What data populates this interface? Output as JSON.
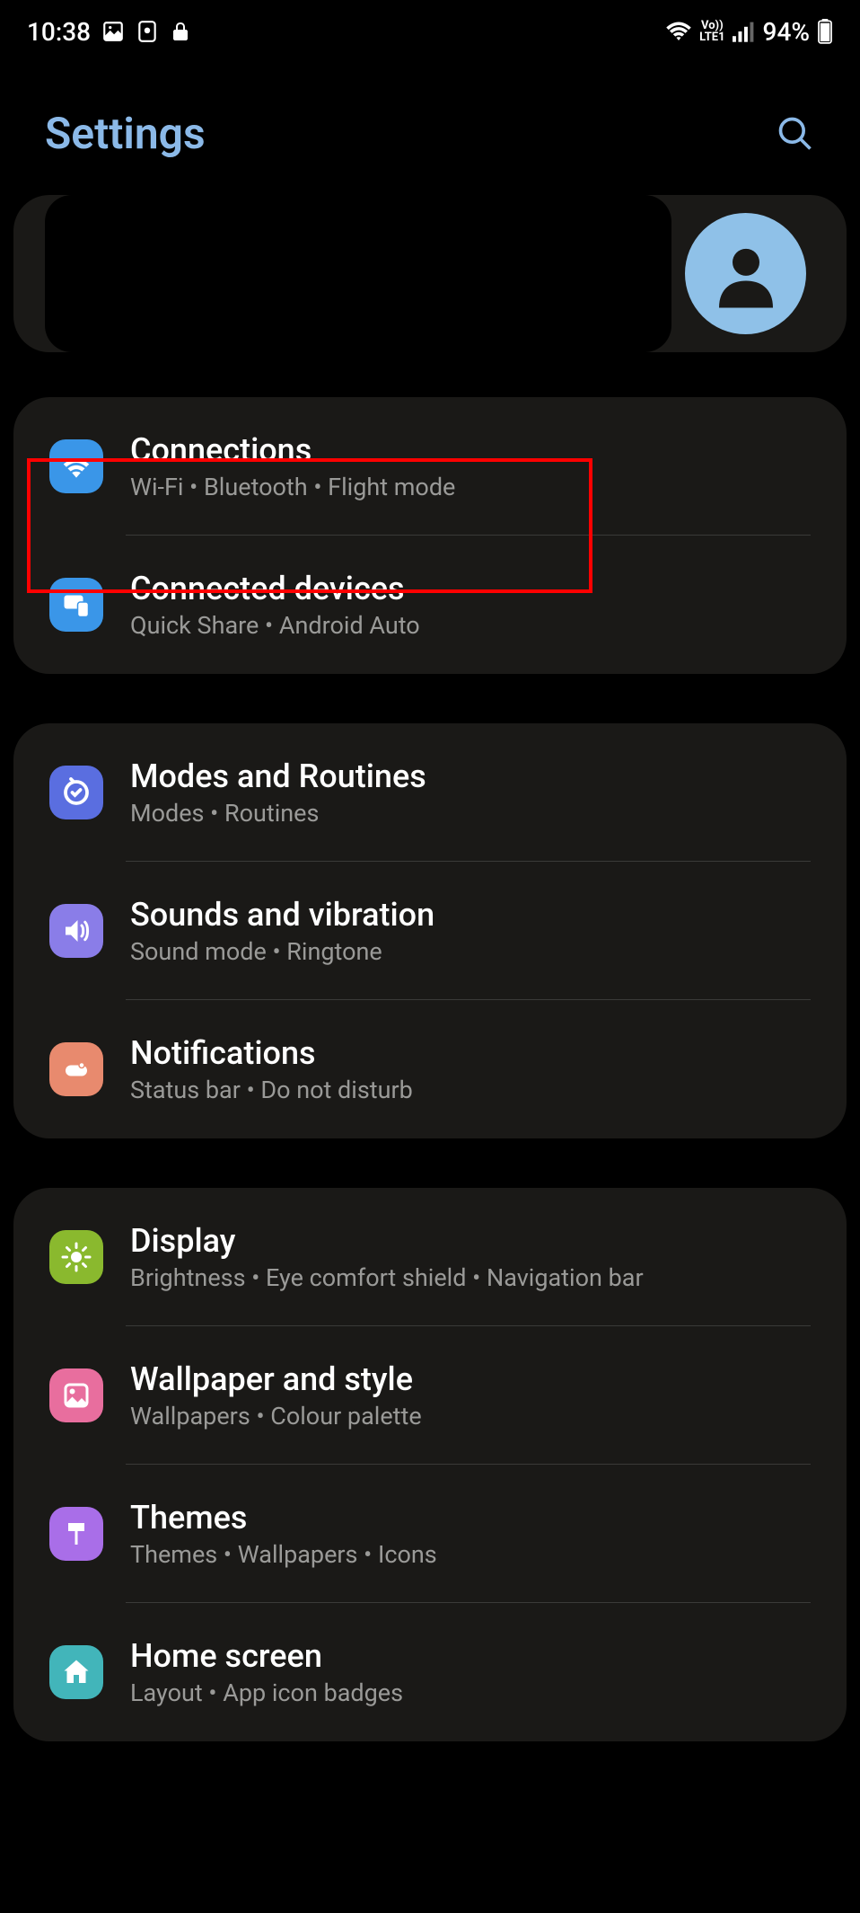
{
  "status_bar": {
    "time": "10:38",
    "battery": "94%",
    "lte_label": "Vo))\nLTE1"
  },
  "header": {
    "title": "Settings"
  },
  "groups": [
    {
      "items": [
        {
          "id": "connections",
          "title": "Connections",
          "subtitle": "Wi-Fi  •  Bluetooth  •  Flight mode",
          "icon_class": "icon-connections"
        },
        {
          "id": "connected-devices",
          "title": "Connected devices",
          "subtitle": "Quick Share  •  Android Auto",
          "icon_class": "icon-connected-devices"
        }
      ]
    },
    {
      "items": [
        {
          "id": "modes-routines",
          "title": "Modes and Routines",
          "subtitle": "Modes  •  Routines",
          "icon_class": "icon-modes"
        },
        {
          "id": "sounds-vibration",
          "title": "Sounds and vibration",
          "subtitle": "Sound mode  •  Ringtone",
          "icon_class": "icon-sounds"
        },
        {
          "id": "notifications",
          "title": "Notifications",
          "subtitle": "Status bar  •  Do not disturb",
          "icon_class": "icon-notifications"
        }
      ]
    },
    {
      "items": [
        {
          "id": "display",
          "title": "Display",
          "subtitle": "Brightness  •  Eye comfort shield  •  Navigation bar",
          "icon_class": "icon-display"
        },
        {
          "id": "wallpaper-style",
          "title": "Wallpaper and style",
          "subtitle": "Wallpapers  •  Colour palette",
          "icon_class": "icon-wallpaper"
        },
        {
          "id": "themes",
          "title": "Themes",
          "subtitle": "Themes  •  Wallpapers  •  Icons",
          "icon_class": "icon-themes"
        },
        {
          "id": "home-screen",
          "title": "Home screen",
          "subtitle": "Layout  •  App icon badges",
          "icon_class": "icon-home"
        }
      ]
    }
  ]
}
